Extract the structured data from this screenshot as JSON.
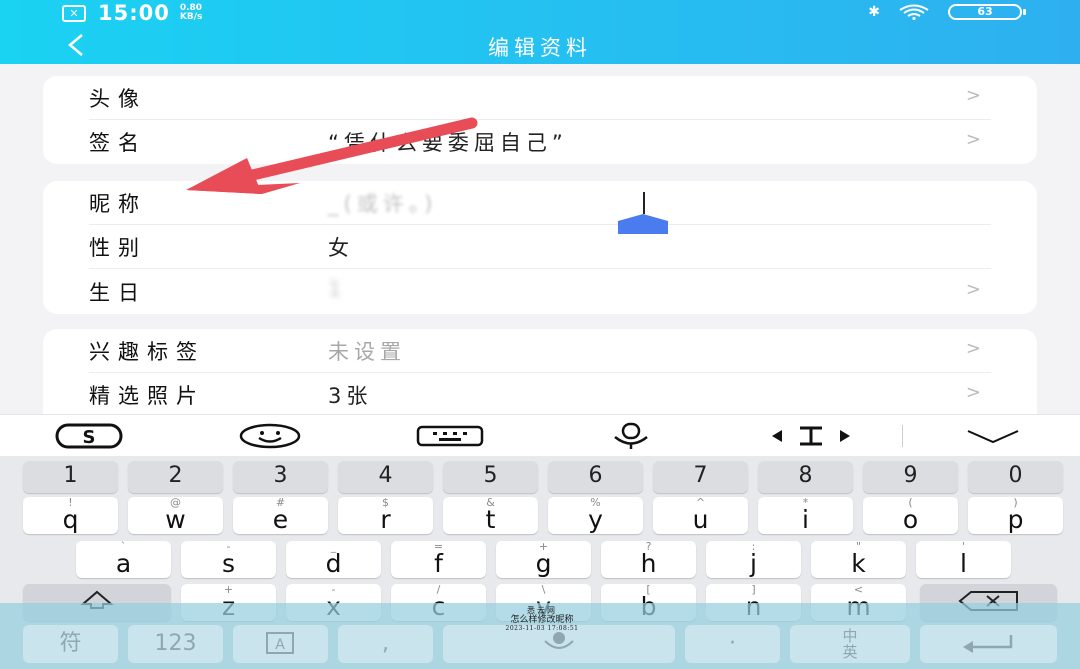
{
  "status_bar": {
    "time": "15:00",
    "net_speed_value": "0.80",
    "net_speed_unit": "KB/s",
    "battery": "63",
    "notification_icon": "close-x"
  },
  "header": {
    "title": "编辑资料",
    "back_icon": "chevron-left-icon"
  },
  "profile": {
    "avatar_label": "头像",
    "signature_label": "签名",
    "signature_value": "“凭什么要委屈自己”",
    "nickname_label": "昵称",
    "nickname_value": "_(或许。)",
    "gender_label": "性别",
    "gender_value": "女",
    "birthday_label": "生日",
    "birthday_value": "1",
    "interests_label": "兴趣标签",
    "interests_value": "未设置",
    "photos_label": "精选照片",
    "photos_value": "3张",
    "chevron": ">"
  },
  "keyboard": {
    "toolbar": [
      "sogou-logo-icon",
      "emoji-icon",
      "keyboard-icon",
      "microphone-icon",
      "cursor-move-icon",
      "collapse-icon"
    ],
    "numbers": [
      "1",
      "2",
      "3",
      "4",
      "5",
      "6",
      "7",
      "8",
      "9",
      "0"
    ],
    "row1": [
      [
        "q",
        "!"
      ],
      [
        "w",
        "@"
      ],
      [
        "e",
        "#"
      ],
      [
        "r",
        "$"
      ],
      [
        "t",
        "&"
      ],
      [
        "y",
        "%"
      ],
      [
        "u",
        "^"
      ],
      [
        "i",
        "*"
      ],
      [
        "o",
        "("
      ],
      [
        "p",
        ")"
      ]
    ],
    "row2": [
      [
        "a",
        "`"
      ],
      [
        "s",
        "-"
      ],
      [
        "d",
        "_"
      ],
      [
        "f",
        "="
      ],
      [
        "g",
        "+"
      ],
      [
        "h",
        "?"
      ],
      [
        "j",
        ":"
      ],
      [
        "k",
        "\""
      ],
      [
        "l",
        "'"
      ]
    ],
    "row3": [
      [
        "z",
        "+"
      ],
      [
        "x",
        "-"
      ],
      [
        "c",
        "/"
      ],
      [
        "v",
        "\\"
      ],
      [
        "b",
        "["
      ],
      [
        "n",
        "]"
      ],
      [
        "m",
        "<"
      ]
    ],
    "bottom": {
      "symbols": "符",
      "numbers": "123",
      "space_label": ",",
      "lang_top": "中",
      "lang_bottom": "英"
    },
    "accent_color": "#4a7cf0"
  },
  "watermark": {
    "line1": "悉云网",
    "line2": "怎么样修改昵称",
    "line3": "2023-11-03 17:08:51"
  },
  "colors": {
    "header": "#1ec8f2",
    "arrow": "#e84c57",
    "cursor_handle": "#4a7cf0"
  }
}
